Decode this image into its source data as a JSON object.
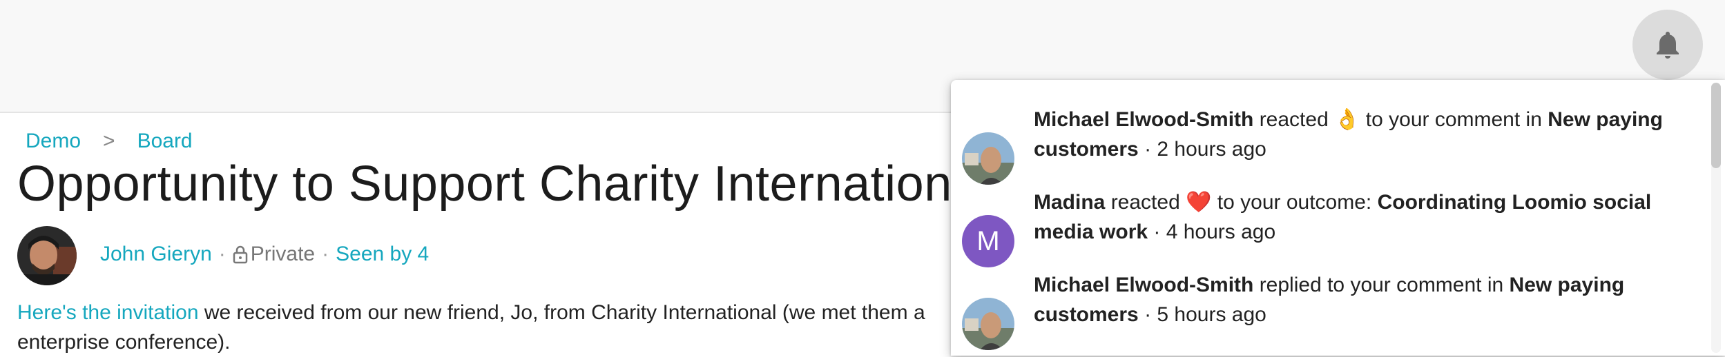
{
  "breadcrumb": {
    "items": [
      "Demo",
      "Board"
    ],
    "separator": ">"
  },
  "thread": {
    "title": "Opportunity to Support Charity International",
    "author": "John Gieryn",
    "dot": "·",
    "privacy": "Private",
    "seen": "Seen by 4",
    "body_link": "Here's the invitation",
    "body_rest": " we received from our new friend, Jo, from Charity International (we met them a",
    "body_line2": "enterprise conference)."
  },
  "notifications": [
    {
      "actor": "Michael Elwood-Smith",
      "action": " reacted ",
      "emoji": "👌",
      "mid": " to your comment in ",
      "target": "New paying customers",
      "time": " · 2 hours ago"
    },
    {
      "actor": "Madina",
      "action": " reacted ",
      "emoji": "❤️",
      "mid": " to your outcome: ",
      "target": "Coordinating Loomio social media work",
      "time": " · 4 hours ago",
      "avatar_letter": "M"
    },
    {
      "actor": "Michael Elwood-Smith",
      "action": " replied to your comment in ",
      "emoji": "",
      "mid": "",
      "target": "New paying customers",
      "time": " · 5 hours ago"
    }
  ],
  "icons": {
    "bell": "bell-icon",
    "lock": "lock-icon"
  },
  "colors": {
    "accent": "#15a7be",
    "avatar_letter_bg": "#7e57c2"
  }
}
